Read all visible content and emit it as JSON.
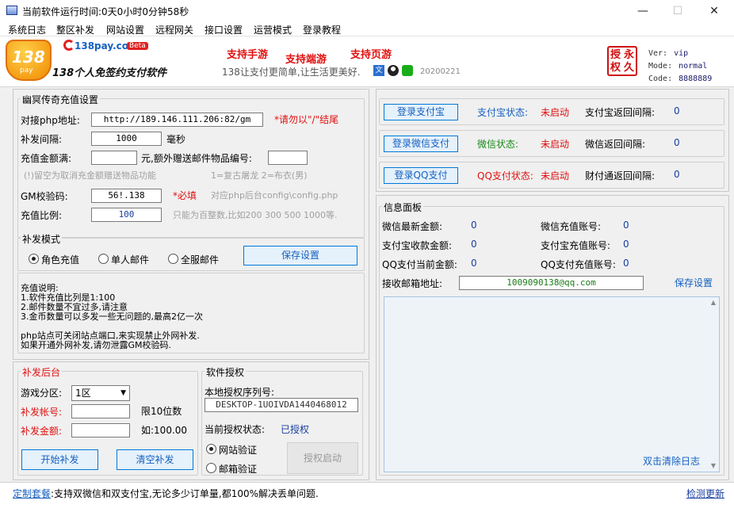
{
  "window": {
    "title": "当前软件运行时间:0天0小时0分钟58秒",
    "minimize": "—",
    "maximize": "☐",
    "close": "✕"
  },
  "menu": [
    "系统日志",
    "整区补发",
    "网站设置",
    "远程网关",
    "接口设置",
    "运营模式",
    "登录教程"
  ],
  "banner": {
    "logo_num": "138",
    "logo_sub": "pay",
    "brand": "138pay.com",
    "beta": "Beta",
    "slogan_main": "138个人免签约支付软件",
    "red_slogans": [
      "支持手游",
      "支持端游",
      "支持页游"
    ],
    "gray_slogan": "138让支付更简单,让生活更美好.",
    "date": "20200221",
    "stamp": [
      "授",
      "永",
      "权",
      "久"
    ],
    "ver_label": "Ver:",
    "ver_value": "vip",
    "mode_label": "Mode:",
    "mode_value": "normal",
    "code_label": "Code:",
    "code_value": "8888889"
  },
  "recharge": {
    "group_title": "幽冥传奇充值设置",
    "php_label": "对接php地址:",
    "php_value": "http://189.146.111.206:82/gm",
    "php_hint": "*请勿以\"/\"结尾",
    "interval_label": "补发间隔:",
    "interval_value": "1000",
    "interval_unit": "毫秒",
    "amount_label": "充值金额满:",
    "amount_mid": "元,额外赠送邮件物品编号:",
    "gift_hint": "(!)留空为取消充金额赠送物品功能",
    "gift_hint2": "1=复古屠龙 2=布衣(男)",
    "gm_label": "GM校验码:",
    "gm_value": "56!.138",
    "gm_required": "*必填",
    "gm_hint": "对应php后台config\\config.php",
    "ratio_label": "充值比例:",
    "ratio_value": "100",
    "ratio_hint": "只能为百整数,比如200 300 500 1000等."
  },
  "mode": {
    "group_title": "补发模式",
    "role": "角色充值",
    "single": "单人邮件",
    "all": "全服邮件",
    "save": "保存设置"
  },
  "notes": [
    "充值说明:",
    "1.软件充值比列是1:100",
    "2.邮件数量不宜过多,请注意",
    "3.金币数量可以多发一些无问题的,最高2亿一次",
    "",
    "php站点可关闭站点端口,来实现禁止外网补发.",
    "如果开通外网补发,请勿泄露GM校验码."
  ],
  "backstage": {
    "group_title": "补发后台",
    "zone_label": "游戏分区:",
    "zone_value": "1区",
    "account_label": "补发帐号:",
    "account_hint": "限10位数",
    "amount_label": "补发金额:",
    "amount_hint": "如:100.00",
    "start": "开始补发",
    "clear": "清空补发"
  },
  "license": {
    "group_title": "软件授权",
    "serial_label": "本地授权序列号:",
    "serial_value": "DESKTOP-1UOIVDA1440468012",
    "status_label": "当前授权状态:",
    "status_value": "已授权",
    "web_verify": "网站验证",
    "mail_verify": "邮箱验证",
    "activate": "授权启动"
  },
  "pay": [
    {
      "button": "登录支付宝",
      "status_label": "支付宝状态:",
      "status": "未启动",
      "interval_label": "支付宝返回间隔:",
      "interval": "0"
    },
    {
      "button": "登录微信支付",
      "status_label": "微信状态:",
      "status": "未启动",
      "interval_label": "微信返回间隔:",
      "interval": "0"
    },
    {
      "button": "登录QQ支付",
      "status_label": "QQ支付状态:",
      "status": "未启动",
      "interval_label": "财付通返回间隔:",
      "interval": "0"
    }
  ],
  "info": {
    "group_title": "信息面板",
    "wx_amount_label": "微信最新金额:",
    "wx_amount": "0",
    "wx_account_label": "微信充值账号:",
    "wx_account": "0",
    "ali_amount_label": "支付宝收款金额:",
    "ali_amount": "0",
    "ali_account_label": "支付宝充值账号:",
    "ali_account": "0",
    "qq_amount_label": "QQ支付当前金额:",
    "qq_amount": "0",
    "qq_account_label": "QQ支付充值账号:",
    "qq_account": "0",
    "mail_label": "接收邮箱地址:",
    "mail_value": "1009090138@qq.com",
    "save": "保存设置",
    "clear_log": "双击清除日志"
  },
  "status_bar": {
    "prefix": "定制套餐",
    "text": ":支持双微信和双支付宝,无论多少订单量,都100%解决丢单问题.",
    "update": "检测更新"
  },
  "colors": {
    "accent": "#1560c0",
    "error": "#e01010",
    "success": "#1a8a1a",
    "border": "#c8c8c8"
  }
}
